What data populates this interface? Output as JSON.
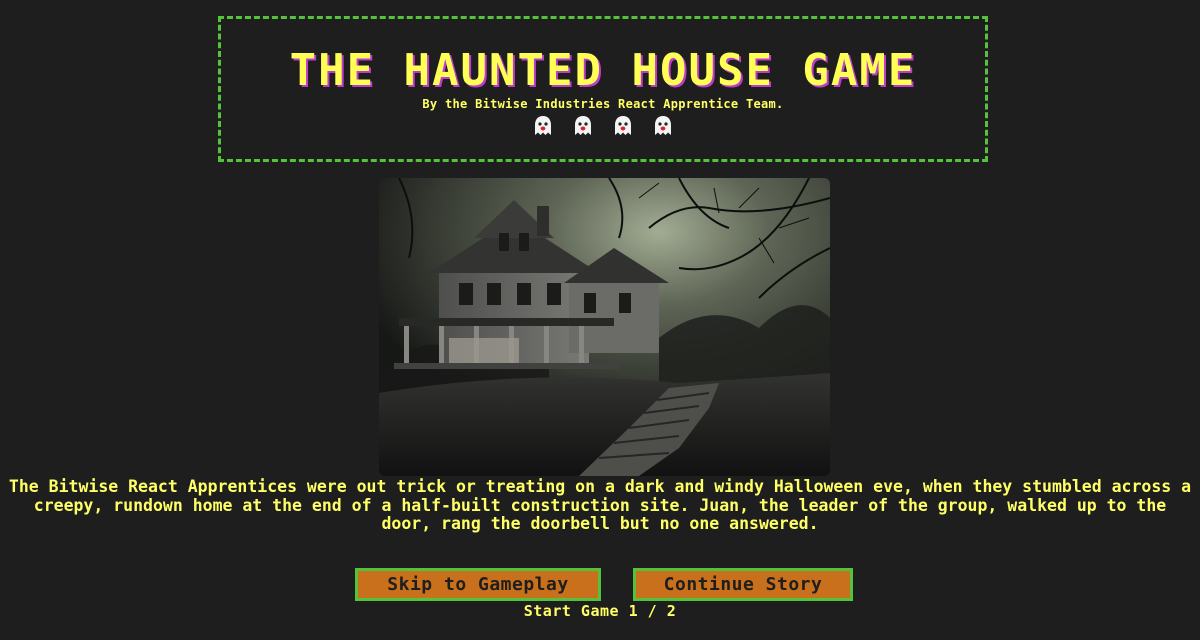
{
  "header": {
    "title": "THE HAUNTED HOUSE GAME",
    "subtitle": "By the Bitwise Industries React Apprentice Team.",
    "ghost_icons": [
      "ghost-icon",
      "ghost-icon",
      "ghost-icon",
      "ghost-icon"
    ]
  },
  "scene": {
    "icon": "haunted-house-photo"
  },
  "story": {
    "text": "The Bitwise React Apprentices were out trick or treating on a dark and windy Halloween eve, when they stumbled across a creepy, rundown home at the end of a half-built construction site. Juan, the leader of the group, walked up to the door, rang the doorbell but no one answered."
  },
  "actions": {
    "skip_label": "Skip to Gameplay",
    "continue_label": "Continue Story"
  },
  "footer": {
    "label": "Start Game",
    "page_current": "1",
    "page_separator": "/",
    "page_total": "2"
  },
  "colors": {
    "background": "#1e1e1e",
    "text": "#ffff66",
    "title_shadow": "#c13ad0",
    "border": "#54c23a",
    "button_fill": "#c8701b"
  }
}
